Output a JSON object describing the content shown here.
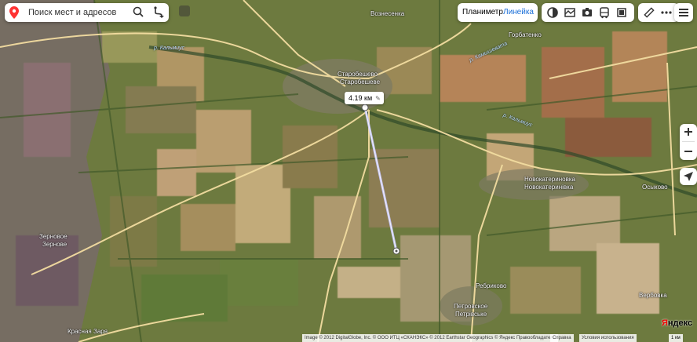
{
  "search": {
    "placeholder": "Поиск мест и адресов"
  },
  "layers": {
    "satellite": "Планиметр",
    "ruler": "Линейка"
  },
  "ruler": {
    "distance": "4.19 км"
  },
  "places": [
    {
      "name": "Старобешево",
      "sub": "Старобешеве"
    },
    {
      "name": "Вознесенка"
    },
    {
      "name": "Горбатенко"
    },
    {
      "name": "Новокатериновка",
      "sub": "Новокатеринівка"
    },
    {
      "name": "Осыково"
    },
    {
      "name": "Зерновое",
      "sub": "Зернове"
    },
    {
      "name": "Петровское",
      "sub": "Петрівське"
    },
    {
      "name": "Ребриково"
    },
    {
      "name": "Красная Заря"
    },
    {
      "name": "Вербовка"
    }
  ],
  "rivers": [
    "р. Кальмиус",
    "р. Камышевата",
    "р. Кальмиус"
  ],
  "footer": {
    "copyright": "Image © 2012 DigitalGlobe, Inc. © ООО ИТЦ «СКАНЭКС» © 2012 Earthstar Geographics © Яндекс  Правообладатели",
    "help": "Справка",
    "terms": "Условия использования",
    "scale": "1 км"
  },
  "brand": {
    "first": "Я",
    "rest": "ндекс"
  },
  "colors": {
    "road": "#f2dca0",
    "ruler": "#c9c9ff",
    "accent": "#1a6fd8",
    "search_pin": "#f33"
  }
}
